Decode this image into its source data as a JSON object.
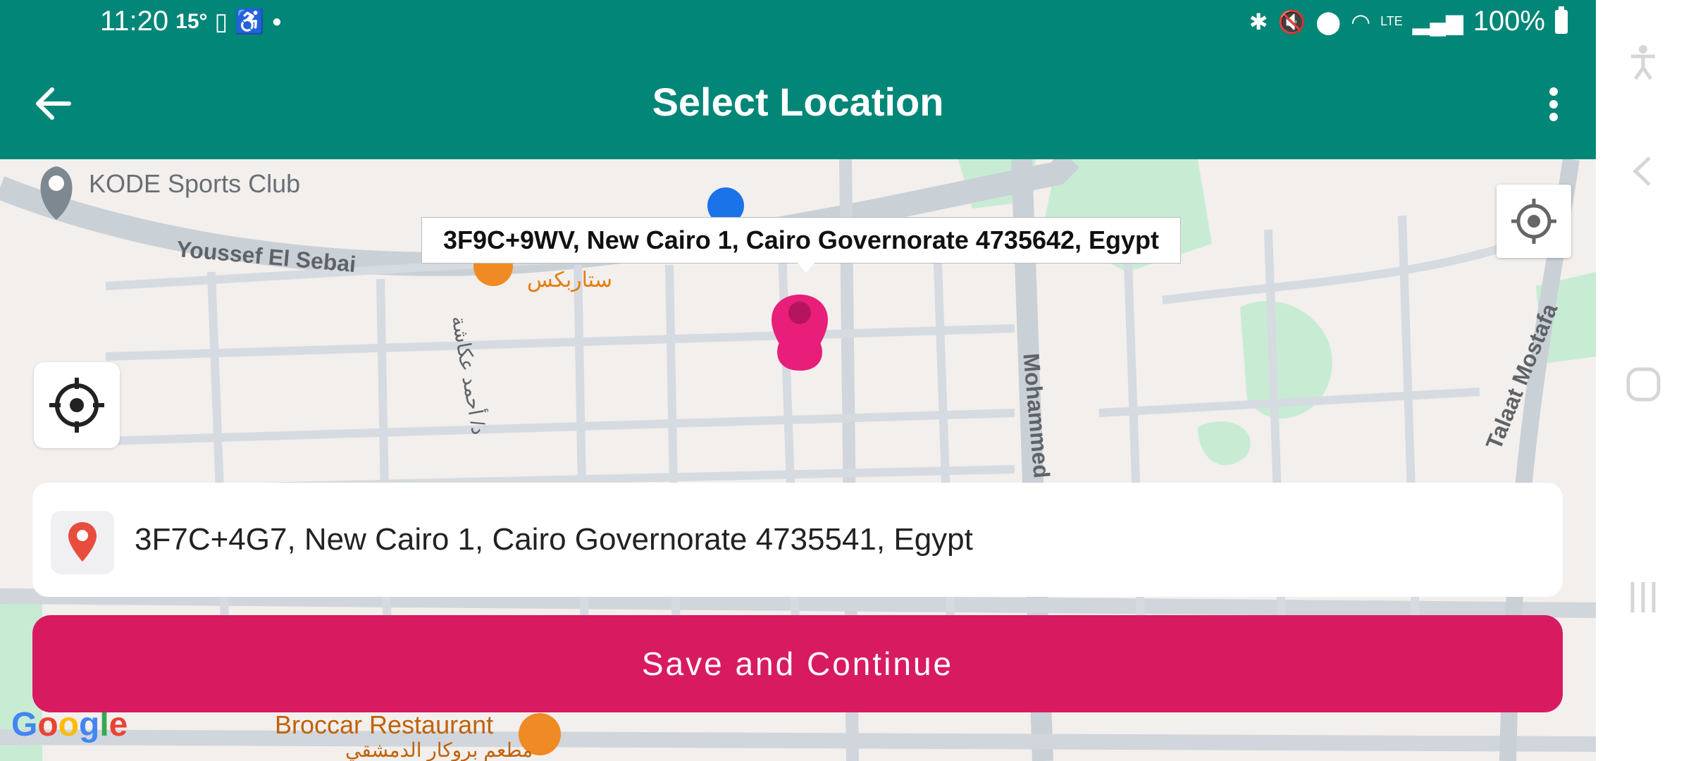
{
  "status_bar": {
    "time": "11:20",
    "temperature": "15°",
    "battery": "100%",
    "icons_left": [
      "phone-screen-icon",
      "accessibility-icon",
      "dot-icon"
    ],
    "icons_right": [
      "bluetooth-icon",
      "mute-icon",
      "location-icon",
      "wifi-icon",
      "volte-icon",
      "signal-icon",
      "battery-icon"
    ]
  },
  "app_bar": {
    "title": "Select Location",
    "back_icon": "arrow-left-icon",
    "menu_icon": "more-vert-icon"
  },
  "map": {
    "poi_kode": "KODE Sports Club",
    "street_youssef": "Youssef El Sebai",
    "street_mohammed": "Mohammed Nag",
    "street_talaat": "Talaat Mostafa",
    "poi_starbucks_ar": "ستاربكس",
    "street_ahmed_ar": "د/ أحمد عكاشة",
    "marker_tooltip": "3F9C+9WV, New Cairo 1, Cairo Governorate 4735642, Egypt",
    "poi_broccar": "Broccar Restaurant",
    "poi_broccar_ar": "مطعم بروكار الدمشقي",
    "google_logo": "Google",
    "colors": {
      "marker": "#e91e7a",
      "road": "#c9d0d6",
      "park": "#c8ebd4",
      "land": "#f2efed"
    }
  },
  "address_field": {
    "value": "3F7C+4G7, New Cairo 1, Cairo Governorate 4735541, Egypt",
    "icon": "location-pin-icon"
  },
  "save_button": {
    "label": "Save and Continue",
    "color": "#d81b60"
  },
  "theme": {
    "primary": "#018677"
  }
}
